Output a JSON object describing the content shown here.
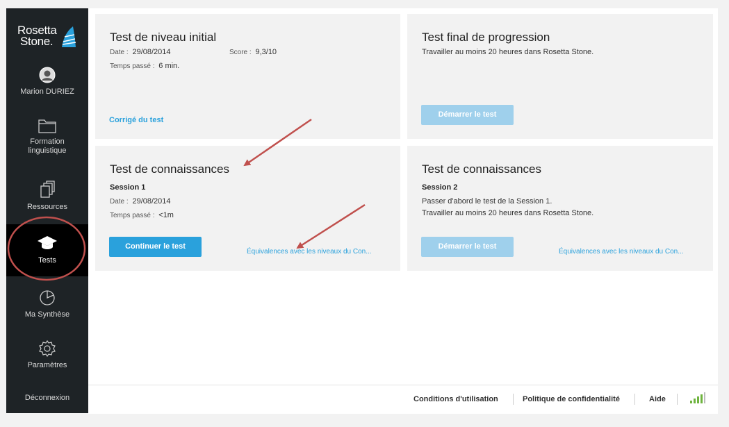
{
  "brand": {
    "line1": "Rosetta",
    "line2": "Stone."
  },
  "sidebar": {
    "user_name": "Marion DURIEZ",
    "items": [
      {
        "label": "Formation linguistique",
        "icon": "folder-icon"
      },
      {
        "label": "Ressources",
        "icon": "documents-icon"
      },
      {
        "label": "Tests",
        "icon": "graduation-cap-icon"
      },
      {
        "label": "Ma Synthèse",
        "icon": "pie-chart-icon"
      },
      {
        "label": "Paramètres",
        "icon": "gear-icon"
      }
    ],
    "logout": "Déconnexion",
    "active": "Tests"
  },
  "cards": {
    "initial": {
      "title": "Test de niveau initial",
      "date_label": "Date :",
      "date": "29/08/2014",
      "score_label": "Score :",
      "score": "9,3/10",
      "time_label": "Temps passé :",
      "time": "6 min.",
      "link": "Corrigé du test"
    },
    "final": {
      "title": "Test final de progression",
      "text": "Travailler au moins 20 heures dans Rosetta Stone.",
      "button": "Démarrer le test"
    },
    "knowledge1": {
      "title": "Test de connaissances",
      "session": "Session 1",
      "date_label": "Date :",
      "date": "29/08/2014",
      "time_label": "Temps passé :",
      "time": "<1m",
      "button": "Continuer le test",
      "link": "Équivalences avec les niveaux du Con..."
    },
    "knowledge2": {
      "title": "Test de connaissances",
      "session": "Session 2",
      "text1": "Passer d'abord le test de la Session 1.",
      "text2": "Travailler au moins 20 heures dans Rosetta Stone.",
      "button": "Démarrer le test",
      "link": "Équivalences avec les niveaux du Con..."
    }
  },
  "footer": {
    "terms": "Conditions d'utilisation",
    "privacy": "Politique de confidentialité",
    "help": "Aide",
    "signal_icon": "signal-strength-icon"
  },
  "colors": {
    "accent": "#2aa1dc",
    "disabled_button": "#9fd0ec",
    "sidebar": "#1e2326",
    "annotation": "#c0504d"
  }
}
